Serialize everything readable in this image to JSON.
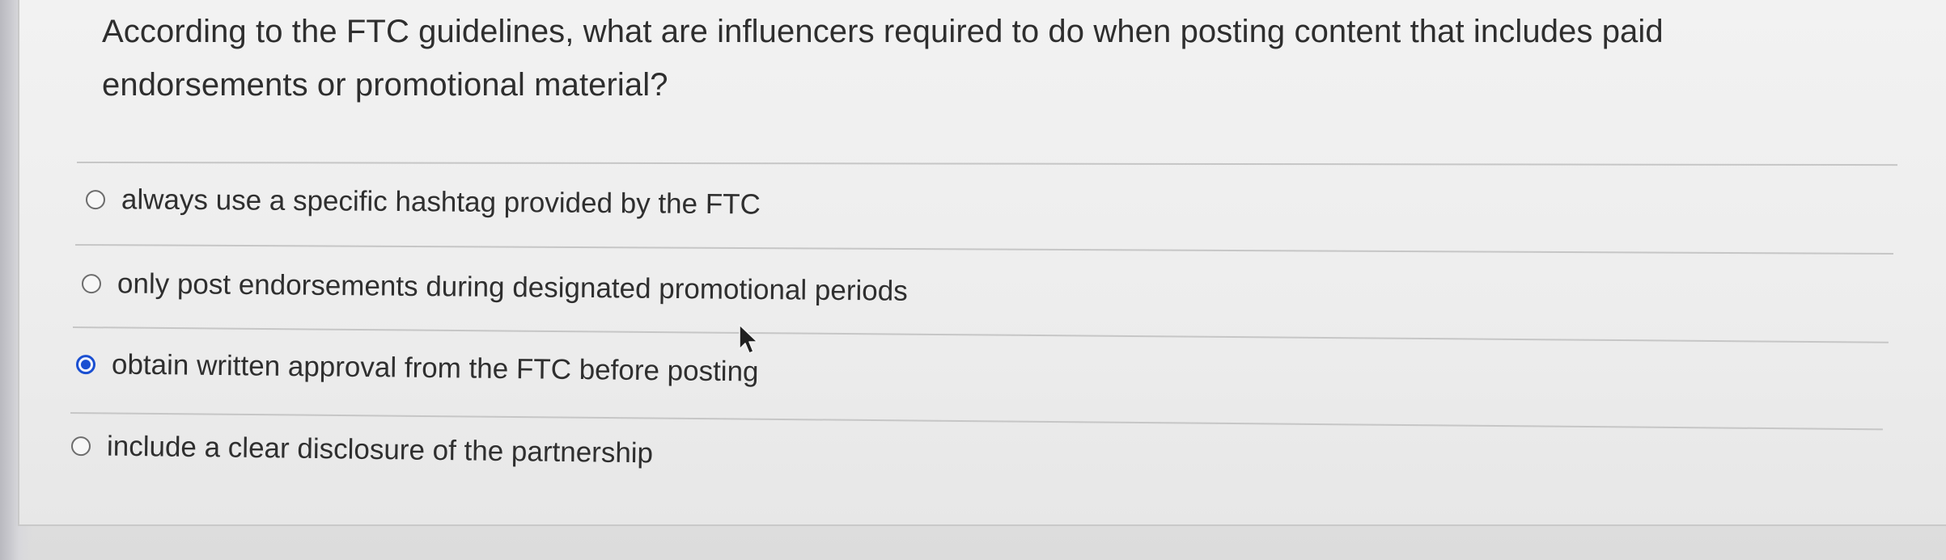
{
  "question": {
    "text": "According to the FTC guidelines, what are influencers required to do when posting content that includes paid endorsements or promotional material?"
  },
  "options": [
    {
      "label": "always use a specific hashtag provided by the FTC",
      "selected": false
    },
    {
      "label": "only post endorsements during designated promotional periods",
      "selected": false
    },
    {
      "label": "obtain written approval from the FTC before posting",
      "selected": true
    },
    {
      "label": "include a clear disclosure of the partnership",
      "selected": false
    }
  ],
  "colors": {
    "accent": "#1a4fd1",
    "text": "#2f2f2f",
    "divider": "#c6c6c6",
    "background": "#ededed"
  },
  "icons": {
    "radio_unselected": "radio-empty-icon",
    "radio_selected": "radio-filled-icon",
    "pointer": "mouse-cursor-icon"
  }
}
